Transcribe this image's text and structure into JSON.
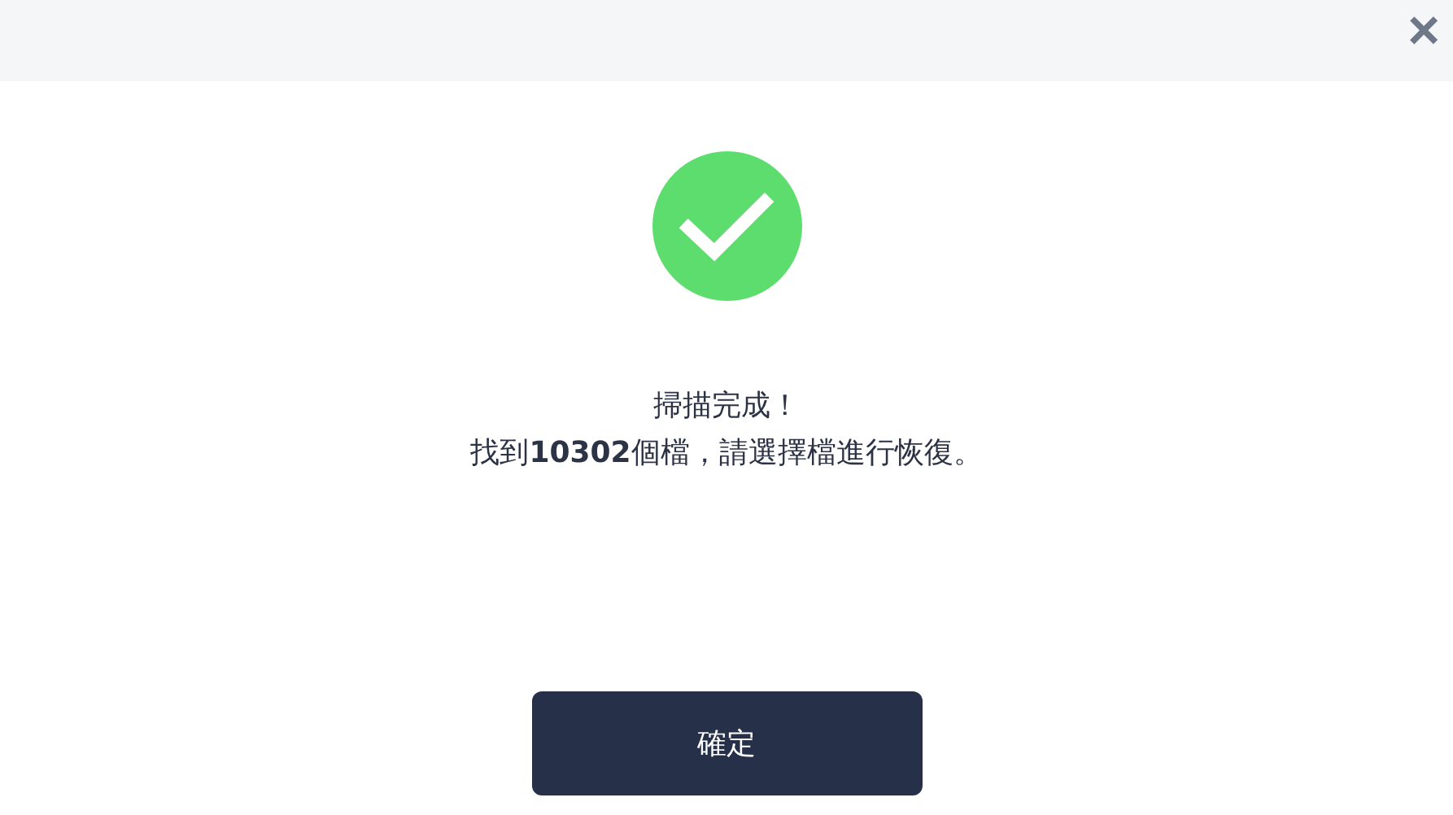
{
  "dialog": {
    "close": "×",
    "kind": "success",
    "message": [
      "掃描完成！",
      "找到**10302**個檔，請選擇檔進行恢復。"
    ],
    "buttons": [
      "確定"
    ]
  }
}
